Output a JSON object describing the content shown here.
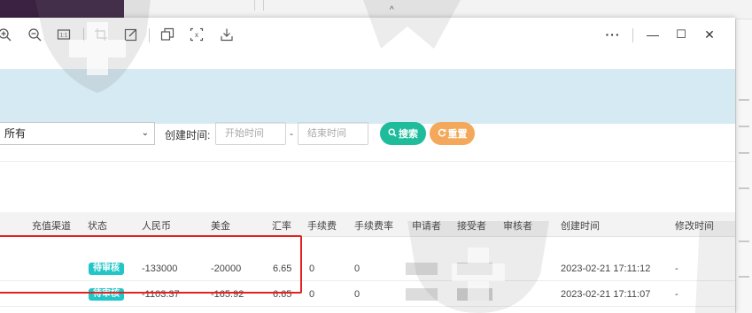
{
  "toolbar": {
    "icons": [
      "zoom-in-icon",
      "zoom-out-icon",
      "fit-icon",
      "crop-icon",
      "edit-icon",
      "copy-icon",
      "extract-text-icon",
      "download-icon"
    ],
    "more": "···",
    "minimize": "—",
    "maximize": "☐",
    "close": "✕"
  },
  "filter": {
    "select_value": "所有",
    "created_label": "创建时间:",
    "start_placeholder": "开始时间",
    "separator": "-",
    "end_placeholder": "结束时间",
    "search_label": "搜索",
    "reset_label": "重置"
  },
  "colors": {
    "badge": "#23c6c8",
    "search": "#1fbc9c",
    "reset": "#f3a85b",
    "highlight": "#e0231e"
  },
  "table": {
    "headers": [
      "充值渠道",
      "状态",
      "人民币",
      "美金",
      "汇率",
      "手续费",
      "手续费率",
      "申请者",
      "接受者",
      "审核者",
      "创建时间",
      "修改时间"
    ],
    "rows": [
      {
        "status": "待审核",
        "rmb": "-133000",
        "usd": "-20000",
        "rate": "6.65",
        "fee": "0",
        "fee_rate": "0",
        "created": "2023-02-21 17:11:12",
        "modified": "-"
      },
      {
        "status": "待审核",
        "rmb": "-1103.37",
        "usd": "-165.92",
        "rate": "6.65",
        "fee": "0",
        "fee_rate": "0",
        "created": "2023-02-21 17:11:07",
        "modified": "-"
      }
    ]
  }
}
